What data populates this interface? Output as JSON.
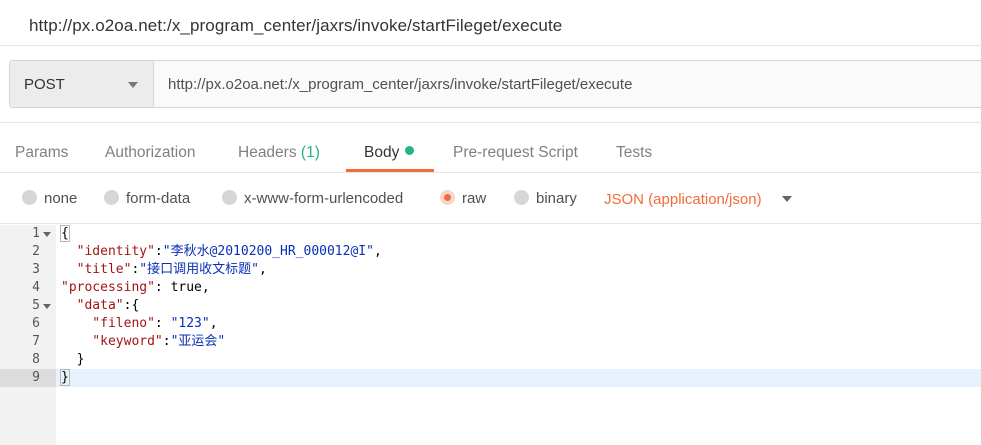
{
  "window": {
    "title": "http://px.o2oa.net:/x_program_center/jaxrs/invoke/startFileget/execute"
  },
  "request": {
    "method": "POST",
    "url": "http://px.o2oa.net:/x_program_center/jaxrs/invoke/startFileget/execute"
  },
  "tabs": [
    {
      "label": "Params"
    },
    {
      "label": "Authorization"
    },
    {
      "label": "Headers",
      "count": "(1)"
    },
    {
      "label": "Body",
      "active": true
    },
    {
      "label": "Pre-request Script"
    },
    {
      "label": "Tests"
    }
  ],
  "body_options": [
    {
      "label": "none",
      "selected": false
    },
    {
      "label": "form-data",
      "selected": false
    },
    {
      "label": "x-www-form-urlencoded",
      "selected": false
    },
    {
      "label": "raw",
      "selected": true
    },
    {
      "label": "binary",
      "selected": false
    }
  ],
  "content_type": "JSON (application/json)",
  "editor": {
    "line_numbers": [
      "1",
      "2",
      "3",
      "4",
      "5",
      "6",
      "7",
      "8",
      "9"
    ],
    "lines": [
      {
        "k": "",
        "sep": "",
        "v": "{",
        "trail": ""
      },
      {
        "k": "  \"identity\"",
        "sep": ":",
        "v": "\"李秋水@2010200_HR_000012@I\"",
        "trail": ","
      },
      {
        "k": "  \"title\"",
        "sep": ":",
        "v": "\"接口调用收文标题\"",
        "trail": ","
      },
      {
        "k": "\"processing\"",
        "sep": ": ",
        "v": "true",
        "trail": ","
      },
      {
        "k": "  \"data\"",
        "sep": ":",
        "v": "{",
        "trail": ""
      },
      {
        "k": "    \"fileno\"",
        "sep": ": ",
        "v": "\"123\"",
        "trail": ","
      },
      {
        "k": "    \"keyword\"",
        "sep": ":",
        "v": "\"亚运会\"",
        "trail": ""
      },
      {
        "k": "",
        "sep": "",
        "v": "  }",
        "trail": ""
      },
      {
        "k": "",
        "sep": "",
        "v": "}",
        "trail": ""
      }
    ]
  },
  "colors": {
    "accent": "#f26b3a",
    "status_green": "#26b47f",
    "json_key": "#a31515",
    "json_string": "#0a2fb5"
  }
}
